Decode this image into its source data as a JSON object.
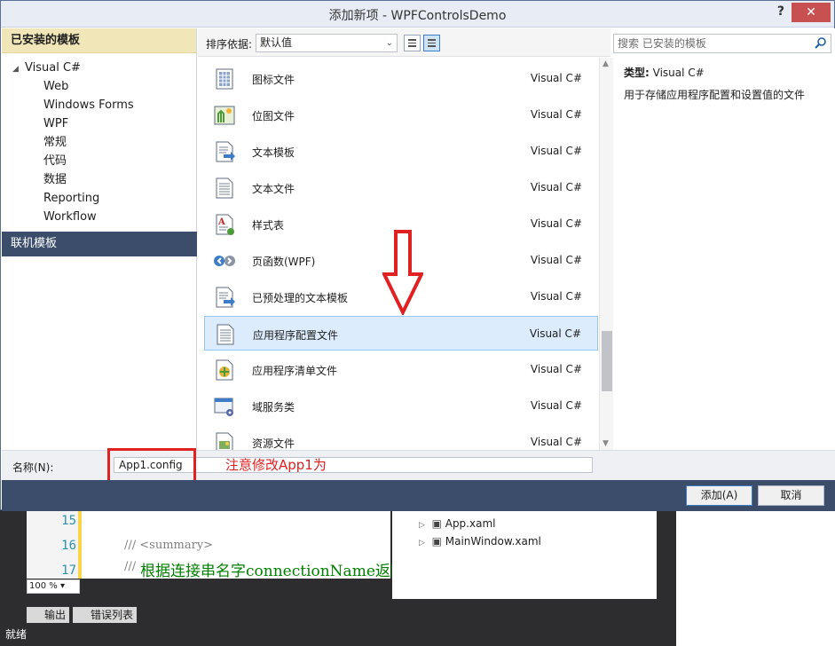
{
  "window": {
    "title": "添加新项 - WPFControlsDemo",
    "help": "?",
    "close": "✕"
  },
  "sidebar": {
    "installed_header": "已安装的模板",
    "root": "Visual C#",
    "children": [
      "Web",
      "Windows Forms",
      "WPF",
      "常规",
      "代码",
      "数据",
      "Reporting",
      "Workflow"
    ],
    "online": "联机模板"
  },
  "sortbar": {
    "label": "排序依据:",
    "value": "默认值"
  },
  "templates": [
    {
      "name": "图标文件",
      "lang": "Visual C#",
      "icon": "icon-file-icon"
    },
    {
      "name": "位图文件",
      "lang": "Visual C#",
      "icon": "bitmap-file-icon"
    },
    {
      "name": "文本模板",
      "lang": "Visual C#",
      "icon": "text-template-icon"
    },
    {
      "name": "文本文件",
      "lang": "Visual C#",
      "icon": "text-file-icon"
    },
    {
      "name": "样式表",
      "lang": "Visual C#",
      "icon": "stylesheet-icon"
    },
    {
      "name": "页函数(WPF)",
      "lang": "Visual C#",
      "icon": "page-function-icon"
    },
    {
      "name": "已预处理的文本模板",
      "lang": "Visual C#",
      "icon": "preprocessed-template-icon"
    },
    {
      "name": "应用程序配置文件",
      "lang": "Visual C#",
      "icon": "config-file-icon",
      "selected": true
    },
    {
      "name": "应用程序清单文件",
      "lang": "Visual C#",
      "icon": "manifest-file-icon"
    },
    {
      "name": "域服务类",
      "lang": "Visual C#",
      "icon": "domain-service-icon"
    },
    {
      "name": "资源文件",
      "lang": "Visual C#",
      "icon": "resource-file-icon"
    }
  ],
  "details": {
    "search_placeholder": "搜索 已安装的模板",
    "type_label": "类型:",
    "type_value": "Visual C#",
    "description": "用于存储应用程序配置和设置值的文件"
  },
  "name_field": {
    "label": "名称(N):",
    "value": "App1.config"
  },
  "annotation": {
    "note": "注意修改App1为App"
  },
  "buttons": {
    "add": "添加(A)",
    "cancel": "取消"
  },
  "ide": {
    "lines": [
      "15",
      "16",
      "17"
    ],
    "code_summary": "/// <summary>",
    "code_comment_prefix": "///",
    "code_comment": "根据连接串名字connectionName返回",
    "solution_items": [
      "App.xaml",
      "MainWindow.xaml"
    ],
    "zoom": "100 %",
    "tab_output": "输出",
    "tab_errors": "错误列表",
    "status": "就绪"
  },
  "colors": {
    "accent": "#3d7dc7",
    "annotation_red": "#e12121",
    "dark_bar": "#3c4d6b"
  }
}
